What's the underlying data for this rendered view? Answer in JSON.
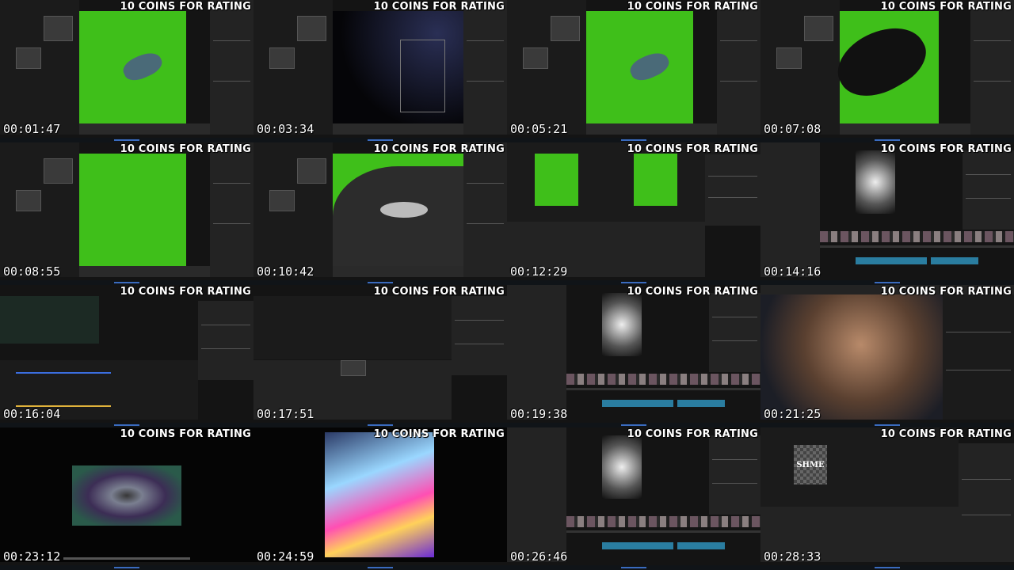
{
  "overlay": {
    "banner_text": "10 COINS FOR RATING"
  },
  "tiles": [
    {
      "timestamp": "00:01:47",
      "scene": "blender-green-screen-car"
    },
    {
      "timestamp": "00:03:34",
      "scene": "blender-space-viewport"
    },
    {
      "timestamp": "00:05:21",
      "scene": "blender-green-screen-car"
    },
    {
      "timestamp": "00:07:08",
      "scene": "blender-green-screen-car-closeup"
    },
    {
      "timestamp": "00:08:55",
      "scene": "blender-green-empty"
    },
    {
      "timestamp": "00:10:42",
      "scene": "blender-headlight-closeup"
    },
    {
      "timestamp": "00:12:29",
      "scene": "compositor-dual-preview"
    },
    {
      "timestamp": "00:14:16",
      "scene": "video-editor-timeline"
    },
    {
      "timestamp": "00:16:04",
      "scene": "fusion-node-graph"
    },
    {
      "timestamp": "00:17:51",
      "scene": "fusion-empty"
    },
    {
      "timestamp": "00:19:38",
      "scene": "video-editor-timeline"
    },
    {
      "timestamp": "00:21:25",
      "scene": "web-browser-photo"
    },
    {
      "timestamp": "00:23:12",
      "scene": "video-player-tunnel"
    },
    {
      "timestamp": "00:24:59",
      "scene": "video-player-colorful"
    },
    {
      "timestamp": "00:26:46",
      "scene": "video-editor-timeline"
    },
    {
      "timestamp": "00:28:33",
      "scene": "video-editor-text"
    }
  ],
  "screen_text": {
    "shme_label": "SHME"
  },
  "colors": {
    "green_screen": "#3fbf1a",
    "ui_dark": "#232323",
    "timeline_blue": "#2a7da0"
  }
}
